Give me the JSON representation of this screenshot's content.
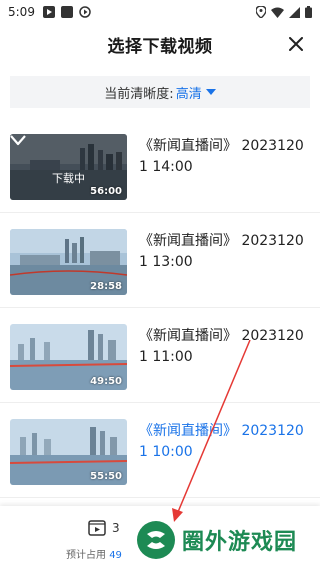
{
  "status_bar": {
    "time": "5:09"
  },
  "header": {
    "title": "选择下载视频"
  },
  "quality": {
    "label": "当前清晰度:",
    "value": "高清"
  },
  "videos": [
    {
      "title": "《新闻直播间》 20231201 14:00",
      "duration": "56:00",
      "downloading": true,
      "download_label": "下载中"
    },
    {
      "title": "《新闻直播间》 20231201 13:00",
      "duration": "28:58",
      "downloading": false
    },
    {
      "title": "《新闻直播间》 20231201 11:00",
      "duration": "49:50",
      "downloading": false
    },
    {
      "title": "《新闻直播间》 20231201 10:00",
      "duration": "55:50",
      "downloading": false,
      "selected": true
    }
  ],
  "bottom_bar": {
    "label_partial": "3",
    "storage_label": "预计占用",
    "storage_value": "49"
  },
  "watermark": {
    "text": "圈外游戏园"
  },
  "colors": {
    "accent": "#1a73e8",
    "watermark": "#1d8a54",
    "annotation": "#e53935"
  }
}
